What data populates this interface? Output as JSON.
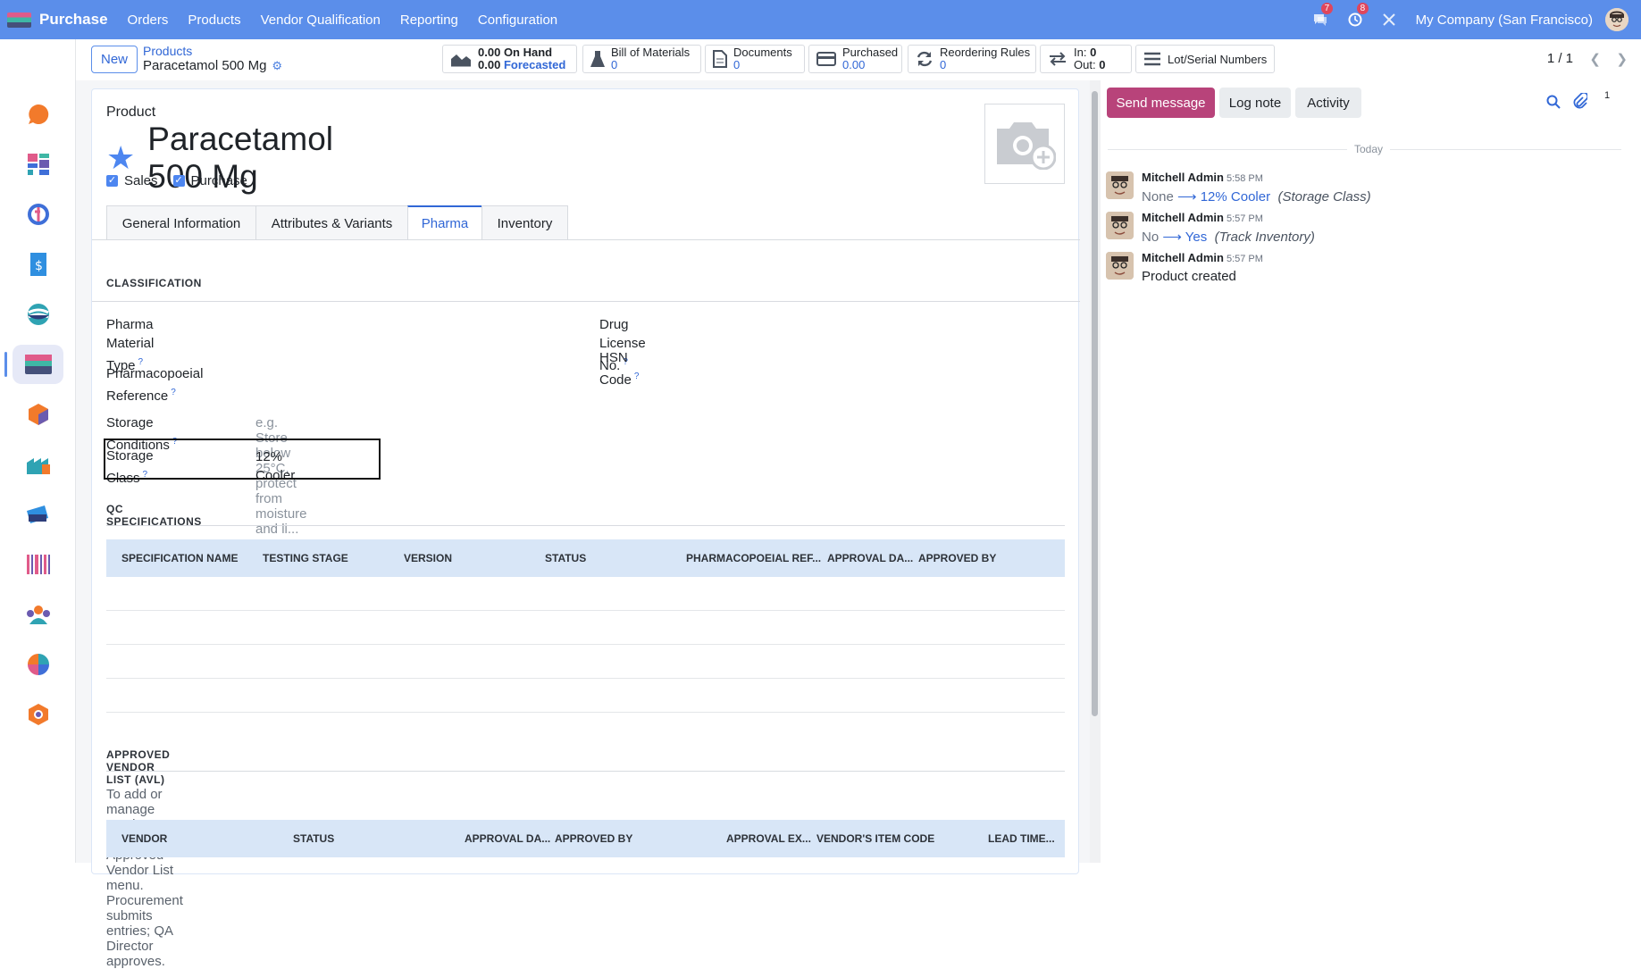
{
  "topbar": {
    "app": "Purchase",
    "menu": [
      "Orders",
      "Products",
      "Vendor Qualification",
      "Reporting",
      "Configuration"
    ],
    "chat_badge": "7",
    "activity_badge": "8",
    "company": "My Company (San Francisco)"
  },
  "control": {
    "new": "New",
    "breadcrumb_parent": "Products",
    "breadcrumb_current": "Paracetamol 500 Mg",
    "pager": "1 / 1",
    "stats": {
      "onhand_val": "0.00",
      "onhand_lbl": "On Hand",
      "forecast_val": "0.00",
      "forecast_lbl": "Forecasted",
      "bom_lbl": "Bill of Materials",
      "bom_val": "0",
      "docs_lbl": "Documents",
      "docs_val": "0",
      "purchased_lbl": "Purchased",
      "purchased_val": "0.00",
      "reorder_lbl": "Reordering Rules",
      "reorder_val": "0",
      "in_lbl": "In:",
      "in_val": "0",
      "out_lbl": "Out:",
      "out_val": "0",
      "lots_lbl": "Lot/Serial Numbers"
    }
  },
  "form": {
    "product_label": "Product",
    "name": "Paracetamol 500 Mg",
    "sales": "Sales",
    "purchase": "Purchase",
    "tabs": [
      "General Information",
      "Attributes & Variants",
      "Pharma",
      "Inventory"
    ],
    "classification": "CLASSIFICATION",
    "f_material_1": "Pharma Material",
    "f_material_2": "Type",
    "f_pharmref_1": "Pharmacopoeial",
    "f_pharmref_2": "Reference",
    "f_storage_cond": "Storage Conditions",
    "storage_cond_placeholder": "e.g. Store below 25°C, protect from moisture and li...",
    "f_storage_class": "Storage Class",
    "storage_class_value": "12% Cooler",
    "f_drug_license": "Drug License No.",
    "f_hsn": "HSN Code",
    "q": "?",
    "qc": "QC SPECIFICATIONS",
    "qc_cols": [
      "SPECIFICATION NAME",
      "TESTING STAGE",
      "VERSION",
      "STATUS",
      "PHARMACOPOEIAL REF...",
      "APPROVAL DA...",
      "APPROVED BY"
    ],
    "avl": "APPROVED VENDOR LIST (AVL)",
    "avl_note": "To add or manage vendors, use the Approved Vendor List menu. Procurement submits entries; QA Director approves.",
    "avl_cols": [
      "VENDOR",
      "STATUS",
      "APPROVAL DA...",
      "APPROVED BY",
      "APPROVAL EX...",
      "VENDOR'S ITEM CODE",
      "LEAD TIME..."
    ]
  },
  "chatter": {
    "send": "Send message",
    "log": "Log note",
    "activity": "Activity",
    "followers": "1",
    "today": "Today",
    "messages": [
      {
        "author": "Mitchell Admin",
        "time": "5:58 PM",
        "old": "None",
        "new": "12% Cooler",
        "field": "(Storage Class)"
      },
      {
        "author": "Mitchell Admin",
        "time": "5:57 PM",
        "old": "No",
        "new": "Yes",
        "field": "(Track Inventory)"
      },
      {
        "author": "Mitchell Admin",
        "time": "5:57 PM",
        "text": "Product created"
      }
    ]
  },
  "colors": {
    "topbar": "#5b8eea",
    "accent": "#3167d6",
    "send": "#b8437a",
    "badge": "#e0465d"
  }
}
